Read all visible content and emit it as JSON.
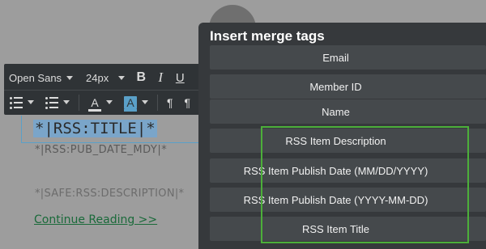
{
  "toolbar": {
    "font_family": "Open Sans",
    "font_size": "24px",
    "bold": "B",
    "italic": "I",
    "underline": "U",
    "text_color": "A",
    "highlight_color": "A",
    "paragraph_ltr": "¶",
    "paragraph_rtl": "¶"
  },
  "editor": {
    "title_tag": "*|RSS:TITLE|*",
    "pub_date_tag": "*|RSS:PUB_DATE_MDY|*",
    "description_tag": "*|SAFE:RSS:DESCRIPTION|*",
    "continue_link": "Continue Reading >>"
  },
  "modal": {
    "title": "Insert merge tags",
    "tags": [
      "Email",
      "Member ID",
      "Name",
      "RSS Item Description",
      "RSS Item Publish Date (MM/DD/YYYY)",
      "RSS Item Publish Date (YYYY-MM-DD)",
      "RSS Item Title"
    ]
  },
  "colors": {
    "highlight_border": "#4caf3a",
    "selection": "#7aa5c9",
    "modal_bg": "#36393c"
  }
}
